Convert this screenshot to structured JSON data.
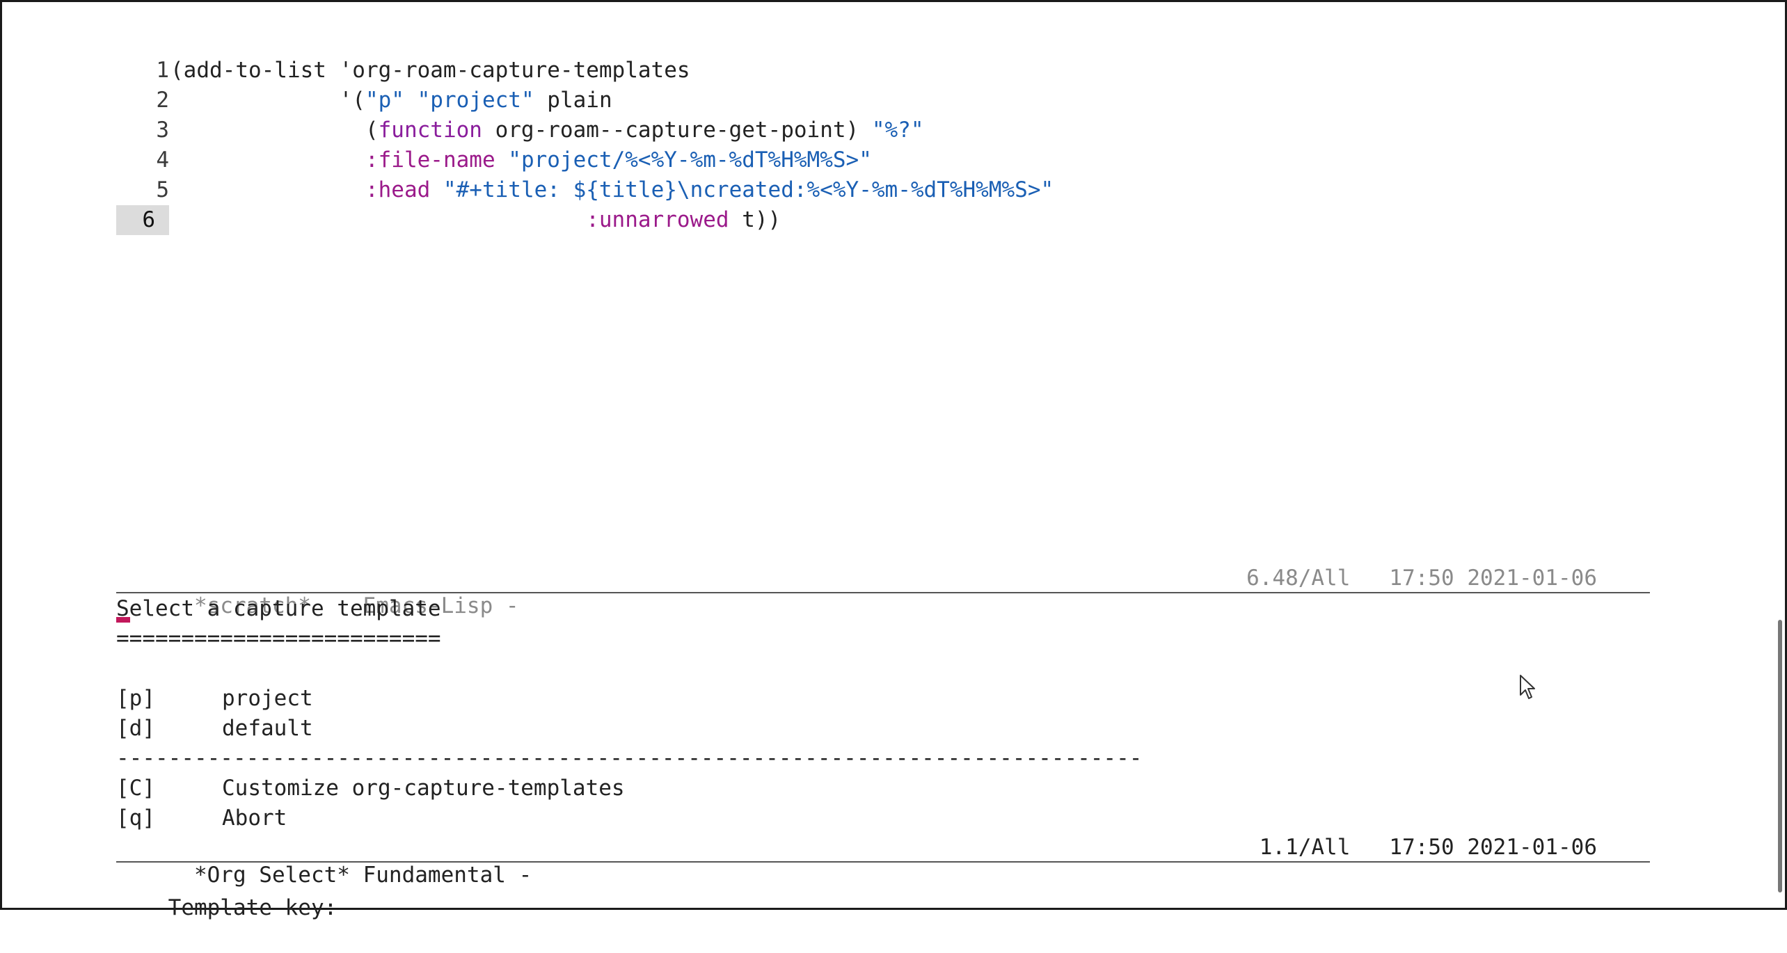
{
  "editor": {
    "lines": [
      {
        "num": "1",
        "segments": [
          {
            "t": "(add-to-list 'org-roam-capture-templates",
            "c": ""
          }
        ]
      },
      {
        "num": "2",
        "segments": [
          {
            "t": "             '(",
            "c": ""
          },
          {
            "t": "\"p\"",
            "c": "str"
          },
          {
            "t": " ",
            "c": ""
          },
          {
            "t": "\"project\"",
            "c": "str"
          },
          {
            "t": " plain",
            "c": ""
          }
        ]
      },
      {
        "num": "3",
        "segments": [
          {
            "t": "               (",
            "c": ""
          },
          {
            "t": "function",
            "c": "kw"
          },
          {
            "t": " org-roam--capture-get-point) ",
            "c": ""
          },
          {
            "t": "\"%?\"",
            "c": "str"
          }
        ]
      },
      {
        "num": "4",
        "segments": [
          {
            "t": "               ",
            "c": ""
          },
          {
            "t": ":file-name",
            "c": "key"
          },
          {
            "t": " ",
            "c": ""
          },
          {
            "t": "\"project/%<%Y-%m-%dT%H%M%S>\"",
            "c": "str"
          }
        ]
      },
      {
        "num": "5",
        "segments": [
          {
            "t": "               ",
            "c": ""
          },
          {
            "t": ":head",
            "c": "key"
          },
          {
            "t": " ",
            "c": ""
          },
          {
            "t": "\"#+title: ${title}\\ncreated:%<%Y-%m-%dT%H%M%S>\"",
            "c": "str"
          }
        ]
      },
      {
        "num": "6",
        "current": true,
        "segments": [
          {
            "t": "                                ",
            "c": ""
          },
          {
            "t": ":unnarrowed",
            "c": "key"
          },
          {
            "t": " t))",
            "c": ""
          }
        ]
      }
    ]
  },
  "modeline_scratch": {
    "buffer": "  *scratch*    Emacs-Lisp -",
    "position": "6.48/All   17:50 2021-01-06"
  },
  "capture": {
    "title_first": "S",
    "title_rest": "elect a capture template",
    "underline": "=========================",
    "options_top": [
      {
        "key": "[p]",
        "label": "project"
      },
      {
        "key": "[d]",
        "label": "default"
      }
    ],
    "separator": "-------------------------------------------------------------------------------",
    "options_bottom": [
      {
        "key": "[C]",
        "label": "Customize org-capture-templates"
      },
      {
        "key": "[q]",
        "label": "Abort"
      }
    ]
  },
  "modeline_select": {
    "buffer": "  *Org Select* Fundamental -",
    "position": "1.1/All   17:50 2021-01-06"
  },
  "minibuffer": {
    "prompt": "Template key: "
  },
  "colors": {
    "string": "#1a5fb4",
    "keyword": "#8a1d9c",
    "cursor": "#c2185b"
  }
}
